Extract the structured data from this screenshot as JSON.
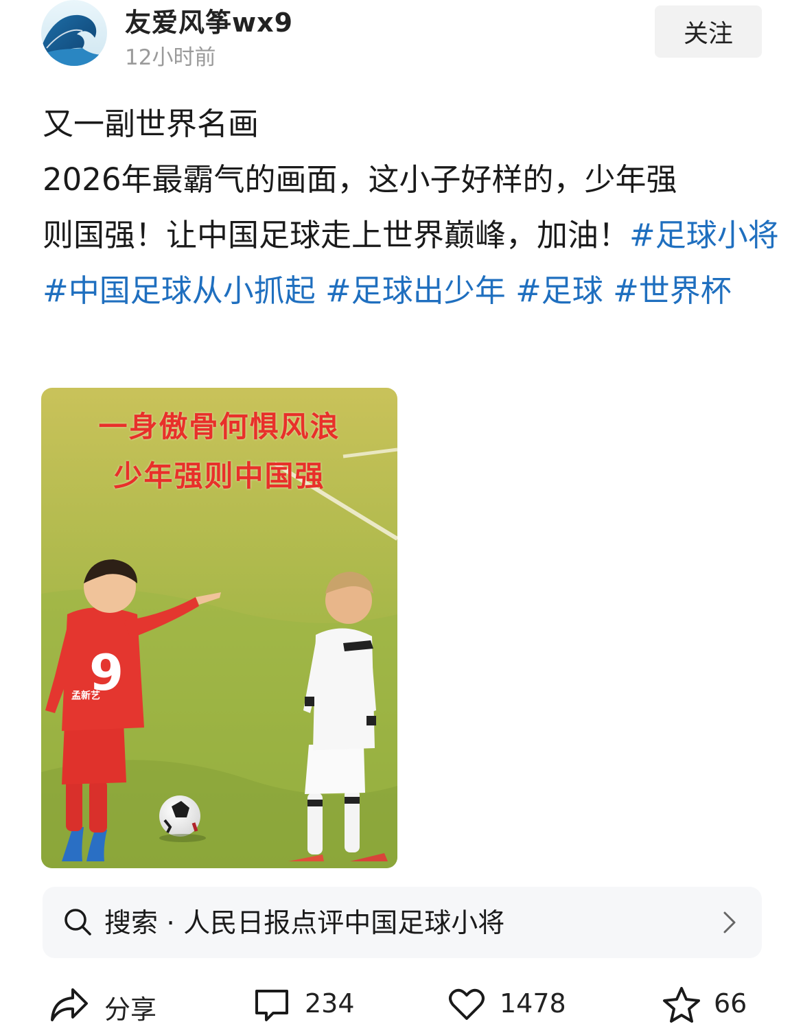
{
  "header": {
    "username": "友爱风筝wx9",
    "post_time": "12小时前",
    "follow_label": "关注"
  },
  "post": {
    "line1": "又一副世界名画",
    "line2": "2026年最霸气的画面，这小子好样的，少年强",
    "line3_text": "则国强！让中国足球走上世界巅峰，加油！",
    "hashtags": [
      "#足球小将",
      "#中国足球从小抓起",
      "#足球出少年",
      "#足球",
      "#世界杯"
    ],
    "hashtag_color": "#1f6fbf"
  },
  "image": {
    "overlay_line1": "一身傲骨何惧风浪",
    "overlay_line2": "少年强则中国强",
    "jersey_number": "9",
    "jersey_name": "孟新艺",
    "overlay_color": "#e8302a"
  },
  "search": {
    "icon": "search-icon",
    "text": "搜索 · 人民日报点评中国足球小将",
    "chevron": "chevron-right-icon"
  },
  "actions": {
    "share_label": "分享",
    "comment_count": "234",
    "like_count": "1478",
    "favorite_count": "66"
  }
}
